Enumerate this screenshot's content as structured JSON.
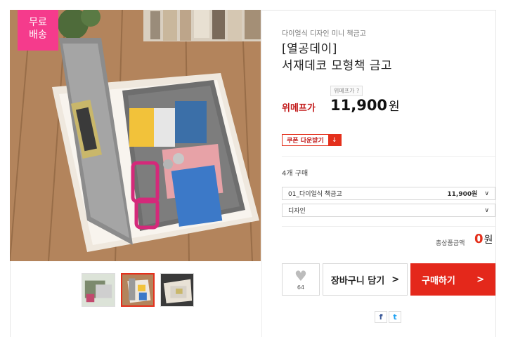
{
  "badge": {
    "line1": "무료",
    "line2": "배송"
  },
  "product": {
    "category": "다이얼식 디자인 미니 책금고",
    "title_line1": "[열공데이]",
    "title_line2": "서재데코 모형책 금고"
  },
  "pricing": {
    "wemep_badge": "위메프가 ?",
    "label": "위메프가",
    "price": "11,900",
    "currency": "원"
  },
  "coupon": {
    "label": "쿠폰 다운받기",
    "icon": "download-arrow-icon",
    "icon_glyph": "↓"
  },
  "purchase_count": "4개 구매",
  "options": [
    {
      "label": "01_다이얼식 책금고",
      "price": "11,900원",
      "chevron": "∨"
    },
    {
      "label": "디자인",
      "price": "",
      "chevron": "∨"
    }
  ],
  "total": {
    "label": "총상품금액",
    "value": "0",
    "currency": "원"
  },
  "actions": {
    "like_count": "64",
    "like_glyph": "♥",
    "cart_label": "장바구니 담기",
    "cart_arrow": ">",
    "buy_label": "구매하기",
    "buy_arrow": ">"
  },
  "share": {
    "facebook": "f",
    "twitter": "t"
  },
  "colors": {
    "accent": "#e4281b",
    "badge": "#f53b8c",
    "price_label": "#c21a1a"
  }
}
